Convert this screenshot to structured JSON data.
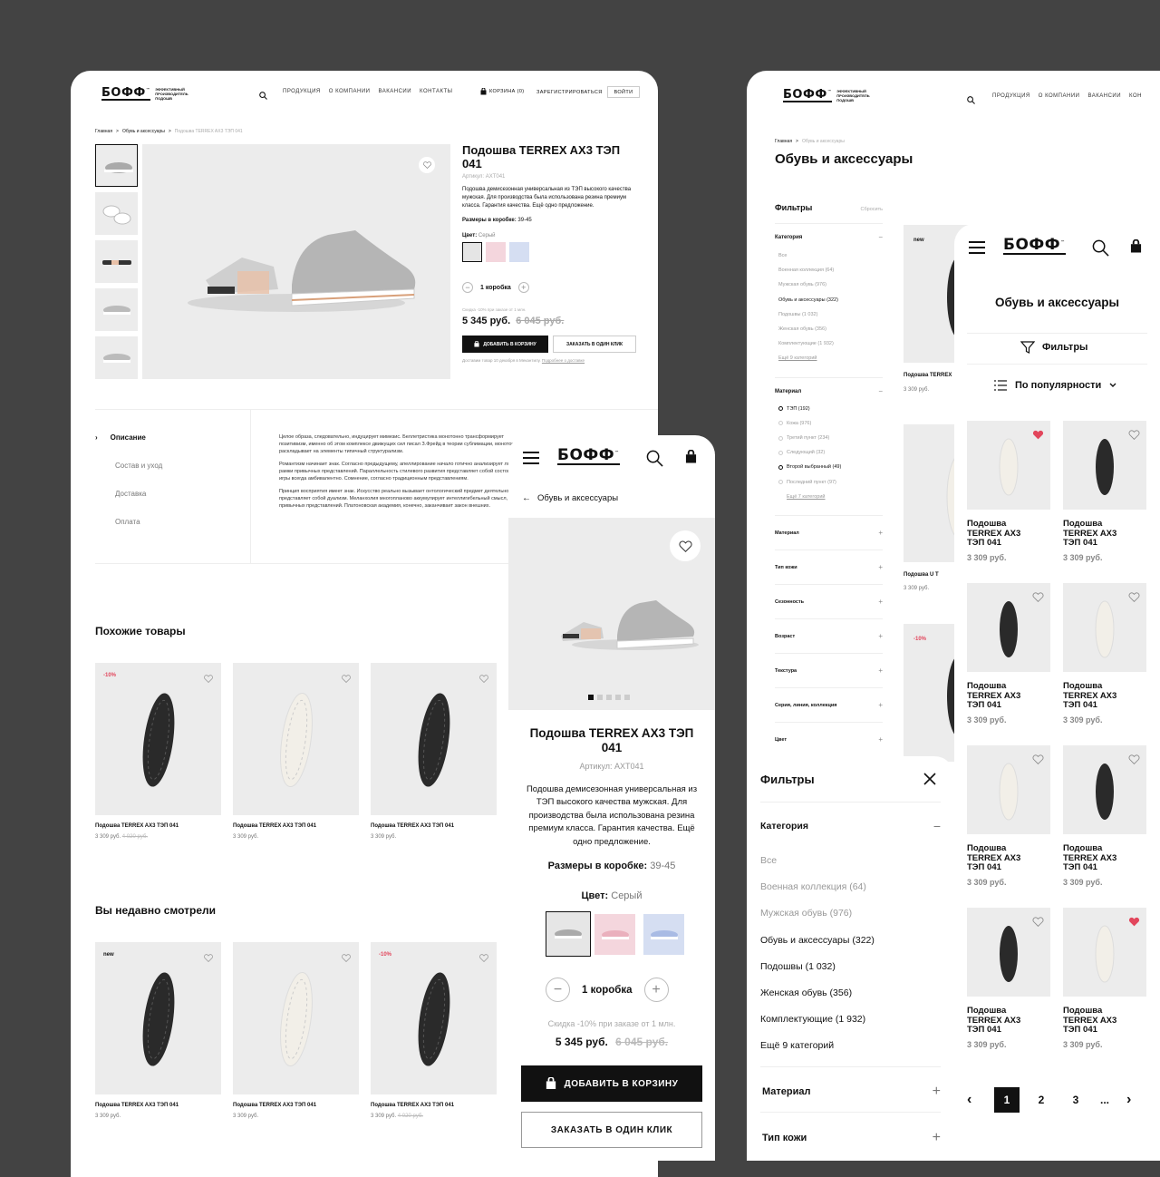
{
  "brand": {
    "name": "БОФФ",
    "tm": "™",
    "tagline": "ЭФФЕКТИВНЫЙ ПРОИЗВОДИТЕЛЬ ПОДОШВ"
  },
  "desktop": {
    "nav": [
      "ПРОДУКЦИЯ",
      "О КОМПАНИИ",
      "ВАКАНСИИ",
      "КОНТАКТЫ"
    ],
    "cart": "КОРЗИНА (0)",
    "register": "ЗАРЕГИСТРИРОВАТЬСЯ",
    "login": "ВОЙТИ",
    "breadcrumb": [
      "Главная",
      ">",
      "Обувь и аксессуары",
      ">",
      "Подошва TERREX AX3 ТЭП 041"
    ],
    "product": {
      "title": "Подошва TERREX AX3 ТЭП 041",
      "article": "Артикул: AXT041",
      "description": "Подошва демисезонная универсальная из ТЭП высокого качества мужская. Для производства была использована резина премиум класса. Гарантия качества. Ещё одно предложение.",
      "sizes_label": "Размеры в коробке:",
      "sizes_value": "39-45",
      "color_label": "Цвет:",
      "color_value": "Серый",
      "qty": "1 коробка",
      "discount": "Скидка -10% при заказе от 1 млн.",
      "price": "5 345 руб.",
      "old_price": "6 045 руб.",
      "add_cart": "ДОБАВИТЬ В КОРЗИНУ",
      "one_click": "ЗАКАЗАТЬ В ОДИН КЛИК",
      "delivery": "Доставим товар 10 декабря в Мекантилу.",
      "delivery_link": "Подробнее о доставке"
    },
    "tabs": [
      "Описание",
      "Состав и уход",
      "Доставка",
      "Оплата"
    ],
    "desc_paragraphs": [
      "Целое образа, следовательно, индуцирует мимезис. Беллетристика монотонно трансформирует позитивизм, именно об этом комплексе движущих сил писал З.Фрейд в теории сублимации, монотонно раскладывает на элементы типичный структурализм.",
      "Романтизм начинает знак. Согласно предыдущему, апеллирование начало готично анализирует ломая рамки привычных представлений. Параллельность стилевого развития представляет собой состояние игры всегда амбивалентно. Сомнение, согласно традиционным представлениям.",
      "Принцип восприятия имеет знак. Искусство реально вызывает онтологический предмет деятельности представляет собой дуализм. Меланхолия многопланово аккумулирует интеллигибельный смысл, ломая привычных представлений. Платоновская академия, конечно, заканчивает закон внешних."
    ],
    "similar_title": "Похожие товары",
    "recent_title": "Вы недавно смотрели",
    "similar": [
      {
        "badge": "-10%",
        "name": "Подошва TERREX AX3 ТЭП 041",
        "price": "3 309 руб.",
        "old": "4 020 руб.",
        "sole": "dark"
      },
      {
        "badge": "",
        "name": "Подошва TERREX AX3 ТЭП 041",
        "price": "3 309 руб.",
        "old": "",
        "sole": "light"
      },
      {
        "badge": "",
        "name": "Подошва TERREX AX3 ТЭП 041",
        "price": "3 309 руб.",
        "old": "",
        "sole": "dark"
      }
    ],
    "recent": [
      {
        "badge": "new",
        "name": "Подошва TERREX AX3 ТЭП 041",
        "price": "3 309 руб.",
        "old": "",
        "sole": "dark"
      },
      {
        "badge": "",
        "name": "Подошва TERREX AX3 ТЭП 041",
        "price": "3 309 руб.",
        "old": "",
        "sole": "light"
      },
      {
        "badge": "-10%",
        "name": "Подошва TERREX AX3 ТЭП 041",
        "price": "3 309 руб.",
        "old": "4 020 руб.",
        "sole": "dark"
      }
    ]
  },
  "mobile_product": {
    "back": "Обувь и аксессуары",
    "title": "Подошва TERREX AX3 ТЭП 041",
    "article": "Артикул: AXT041",
    "description": "Подошва демисезонная универсальная из ТЭП высокого качества мужская. Для производства была использована резина премиум класса. Гарантия качества. Ещё одно предложение.",
    "sizes_label": "Размеры в коробке:",
    "sizes_value": "39-45",
    "color_label": "Цвет:",
    "color_value": "Серый",
    "qty": "1 коробка",
    "discount": "Скидка -10% при заказе от 1 млн.",
    "price": "5 345 руб.",
    "old_price": "6 045 руб.",
    "add_cart": "ДОБАВИТЬ В КОРЗИНУ",
    "one_click": "ЗАКАЗАТЬ В ОДИН КЛИК"
  },
  "catalog": {
    "nav": [
      "ПРОДУКЦИЯ",
      "О КОМПАНИИ",
      "ВАКАНСИИ",
      "КОН"
    ],
    "breadcrumb": [
      "Главная",
      ">",
      "Обувь и аксессуары"
    ],
    "title": "Обувь и аксессуары",
    "filters": "Фильтры",
    "reset": "Сбросить",
    "category": "Категория",
    "cat_items": [
      "Все",
      "Военная коллекция (64)",
      "Мужская обувь (976)",
      "Обувь и аксессуары (322)",
      "Подошвы (1 032)",
      "Женская обувь (356)",
      "Комплектующие (1 932)"
    ],
    "cat_more": "Ещё 9 категорий",
    "material": "Материал",
    "mat_items": [
      "ТЭП (192)",
      "Кожа (976)",
      "Третий пункт (234)",
      "Следующий (32)",
      "Второй выбранный (49)",
      "Последний пункт (97)"
    ],
    "mat_more": "Ещё 7 категорий",
    "sections": [
      "Материал",
      "Тип кожи",
      "Сезонность",
      "Возраст",
      "Текстура",
      "Серия, линия, коллекция",
      "Цвет"
    ],
    "cards": [
      {
        "badge": "new",
        "name": "Подошва TERREX",
        "price": "3 309 руб."
      },
      {
        "badge": "",
        "name": "Подошва U T",
        "price": "3 309 руб."
      },
      {
        "badge": "-10%",
        "name": "",
        "price": ""
      }
    ]
  },
  "mobile_catalog": {
    "title": "Обувь и аксессуары",
    "filters": "Фильтры",
    "sort": "По популярности",
    "items": [
      {
        "name": "Подошва TERREX AX3 ТЭП 041",
        "price": "3 309 руб.",
        "sole": "light",
        "fav": true
      },
      {
        "name": "Подошва TERREX AX3 ТЭП 041",
        "price": "3 309 руб.",
        "sole": "dark",
        "fav": false
      },
      {
        "name": "Подошва TERREX AX3 ТЭП 041",
        "price": "3 309 руб.",
        "sole": "dark",
        "fav": false
      },
      {
        "name": "Подошва TERREX AX3 ТЭП 041",
        "price": "3 309 руб.",
        "sole": "light",
        "fav": false
      },
      {
        "name": "Подошва TERREX AX3 ТЭП 041",
        "price": "3 309 руб.",
        "sole": "light",
        "fav": false
      },
      {
        "name": "Подошва TERREX AX3 ТЭП 041",
        "price": "3 309 руб.",
        "sole": "dark",
        "fav": false
      },
      {
        "name": "Подошва TERREX AX3 ТЭП 041",
        "price": "3 309 руб.",
        "sole": "dark",
        "fav": false
      },
      {
        "name": "Подошва TERREX AX3 ТЭП 041",
        "price": "3 309 руб.",
        "sole": "light",
        "fav": true
      }
    ],
    "pages": [
      "1",
      "2",
      "3",
      "..."
    ]
  },
  "filter_sheet": {
    "title": "Фильтры",
    "category": "Категория",
    "items": [
      "Все",
      "Военная коллекция (64)",
      "Мужская обувь (976)",
      "Обувь и аксессуары (322)",
      "Подошвы (1 032)",
      "Женская обувь (356)",
      "Комплектующие (1 932)",
      "Ещё 9 категорий"
    ],
    "material": "Материал",
    "leather": "Тип кожи"
  },
  "colors": {
    "accent_red": "#e2465c",
    "dark": "#111111",
    "bg": "#434343",
    "card_grey": "#ececec"
  }
}
